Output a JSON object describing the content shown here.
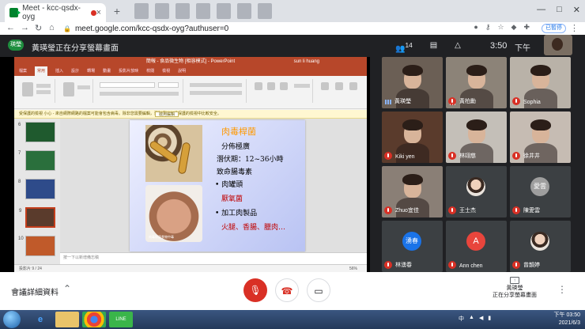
{
  "browser": {
    "tab_title": "Meet - kcc-qsdx-oyg",
    "tab_close": "×",
    "new_tab": "+",
    "url": "meet.google.com/kcc-qsdx-oyg?authuser=0",
    "profile_label": "已暫停",
    "window_controls": [
      "—",
      "□",
      "✕"
    ]
  },
  "meet_header": {
    "presenter_badge": "瑛瑩",
    "present_banner": "黃瑛瑩正在分享螢幕畫面",
    "participants_count": "14",
    "time": "3:50",
    "time_suffix": "下午",
    "self_label": "你"
  },
  "presentation": {
    "app_title": "簡報 - 食品微生物 [相容模式] - PowerPoint",
    "user_name": "sun li huang",
    "ribbon_tabs": [
      "檔案",
      "常用",
      "插入",
      "設計",
      "轉場",
      "動畫",
      "投影片放映",
      "校閱",
      "檢視",
      "說明"
    ],
    "active_tab": "常用",
    "notice_text": "受保護的檢視  小心 - 來自網際網路的檔案可能會包含病毒。除非您需要編輯，否則保持在受保護的檢視中比較安全。",
    "notice_button": "啟用編輯",
    "slide_numbers": [
      "6",
      "7",
      "8",
      "9",
      "10"
    ],
    "notes_placeholder": "按一下以新增備忘稿",
    "status_left": "投影片 9 / 24",
    "status_zoom": "56%",
    "slide": {
      "title": "肉毒桿菌",
      "lines": [
        {
          "text": "分佈極廣",
          "color": "#000000"
        },
        {
          "text": "潛伏期：12~36小時",
          "color": "#000000"
        },
        {
          "text": "致命腸毒素",
          "color": "#000000"
        },
        {
          "text": "• 肉罐頭",
          "color": "#000000"
        },
        {
          "text": "厭氧菌",
          "color": "#c00000"
        },
        {
          "text": "• 加工肉製品",
          "color": "#000000"
        },
        {
          "text": "火腿、香腸、臘肉…",
          "color": "#c00000"
        }
      ],
      "photo_caption": "肉毒桿菌食物中毒"
    }
  },
  "participants": [
    {
      "name": "黃瑛瑩",
      "kind": "video",
      "bg": "#6b5f55",
      "muted": false
    },
    {
      "name": "黃柏勳",
      "kind": "video",
      "bg": "#8c8378",
      "muted": true
    },
    {
      "name": "Sophia",
      "kind": "video",
      "bg": "#b9b2a8",
      "muted": true
    },
    {
      "name": "Kiki yen",
      "kind": "video",
      "bg": "#5a3b2c",
      "muted": true
    },
    {
      "name": "林翊慈",
      "kind": "video",
      "bg": "#c4bfb8",
      "muted": true
    },
    {
      "name": "徐井井",
      "kind": "video",
      "bg": "#c6bcb3",
      "muted": true
    },
    {
      "name": "Zhuo宜佳",
      "kind": "video",
      "bg": "#8a7f76",
      "muted": true
    },
    {
      "name": "王士杰",
      "kind": "photo",
      "bg": "#3c4043",
      "muted": true
    },
    {
      "name": "陳愛雲",
      "kind": "avatar",
      "initial": "愛雲",
      "avatar_color": "#9e9e9e",
      "bg": "#3c4043",
      "muted": true
    },
    {
      "name": "林湧春",
      "kind": "avatar",
      "initial": "湧春",
      "avatar_color": "#1a73e8",
      "bg": "#3c4043",
      "muted": true
    },
    {
      "name": "Ann chen",
      "kind": "avatar",
      "initial": "A",
      "avatar_color": "#e8453c",
      "bg": "#3c4043",
      "muted": true
    },
    {
      "name": "曾韻婷",
      "kind": "photo",
      "bg": "#3c4043",
      "muted": true
    }
  ],
  "controls": {
    "meeting_details": "會議詳細資料",
    "presenting_name": "黃瑛瑩",
    "presenting_status": "正在分享螢幕畫面"
  },
  "taskbar": {
    "tray_lang": "中",
    "time": "下午 03:50",
    "date": "2021/6/3"
  }
}
